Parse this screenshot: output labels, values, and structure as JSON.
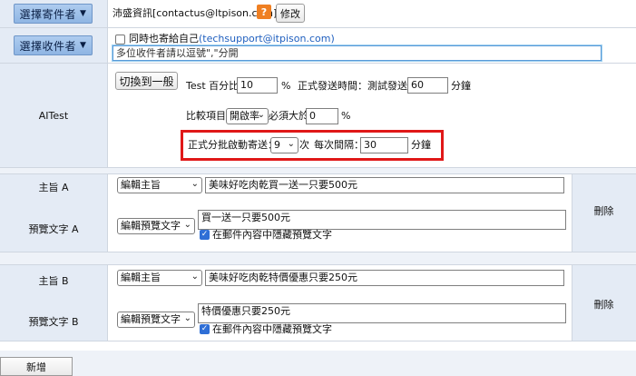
{
  "sender": {
    "button_label": "選擇寄件者",
    "arrow": "▼",
    "value": "沛盛資訊[contactus@ltpison.com]",
    "help_icon": "?",
    "edit_label": "修改"
  },
  "recipient": {
    "button_label": "選擇收件者",
    "arrow": "▼",
    "send_self_label": "同時也寄給自己",
    "self_email": "(techsupport@itpison.com)",
    "input_placeholder": "多位收件者請以逗號\",\"分開",
    "send_self_checked": false
  },
  "ai_test": {
    "label": "AITest",
    "switch_button": "切換到一般",
    "test_percent_label": "Test 百分比",
    "test_percent_value": "10",
    "percent_unit": "%",
    "official_time_label": "正式發送時間：測試發送後",
    "official_time_value": "60",
    "minute_unit": "分鐘",
    "compare_label": "比較項目",
    "compare_value": "開啟率",
    "must_exceed_label": "必須大於",
    "must_exceed_value": "0",
    "batch_label": "正式分批啟動寄送：",
    "batch_value": "9",
    "batch_unit": "次",
    "interval_label": "每次間隔：",
    "interval_value": "30",
    "interval_unit": "分鐘"
  },
  "variant_a": {
    "subject_label": "主旨 A",
    "subject_select": "編輯主旨",
    "subject_value": "美味好吃肉乾買一送一只要500元",
    "preview_label": "預覽文字 A",
    "preview_select": "編輯預覽文字",
    "preview_value": "買一送一只要500元",
    "hide_preview_label": "在郵件內容中隱藏預覽文字",
    "hide_checked": true,
    "delete_label": "刪除"
  },
  "variant_b": {
    "subject_label": "主旨 B",
    "subject_select": "編輯主旨",
    "subject_value": "美味好吃肉乾特價優惠只要250元",
    "preview_label": "預覽文字 B",
    "preview_select": "編輯預覽文字",
    "preview_value": "特價優惠只要250元",
    "hide_preview_label": "在郵件內容中隱藏預覽文字",
    "hide_checked": true,
    "delete_label": "刪除"
  },
  "add_label": "新增",
  "colors": {
    "label_bg": "#e4ebf5",
    "blue_button": "#9dbfe9",
    "highlight_border": "#e01818",
    "help_icon": "#ef7f22"
  }
}
